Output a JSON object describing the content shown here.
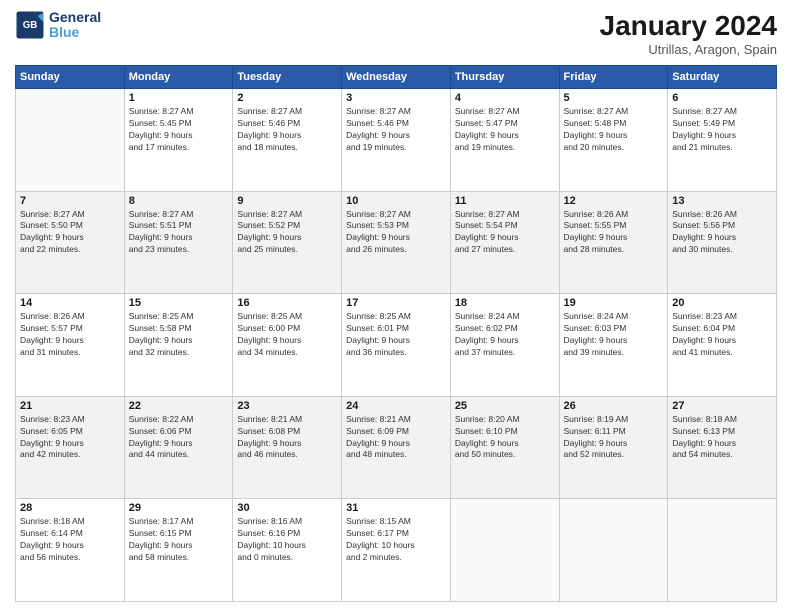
{
  "header": {
    "logo_line1": "General",
    "logo_line2": "Blue",
    "month": "January 2024",
    "location": "Utrillas, Aragon, Spain"
  },
  "weekdays": [
    "Sunday",
    "Monday",
    "Tuesday",
    "Wednesday",
    "Thursday",
    "Friday",
    "Saturday"
  ],
  "weeks": [
    [
      {
        "day": "",
        "info": ""
      },
      {
        "day": "1",
        "info": "Sunrise: 8:27 AM\nSunset: 5:45 PM\nDaylight: 9 hours\nand 17 minutes."
      },
      {
        "day": "2",
        "info": "Sunrise: 8:27 AM\nSunset: 5:46 PM\nDaylight: 9 hours\nand 18 minutes."
      },
      {
        "day": "3",
        "info": "Sunrise: 8:27 AM\nSunset: 5:46 PM\nDaylight: 9 hours\nand 19 minutes."
      },
      {
        "day": "4",
        "info": "Sunrise: 8:27 AM\nSunset: 5:47 PM\nDaylight: 9 hours\nand 19 minutes."
      },
      {
        "day": "5",
        "info": "Sunrise: 8:27 AM\nSunset: 5:48 PM\nDaylight: 9 hours\nand 20 minutes."
      },
      {
        "day": "6",
        "info": "Sunrise: 8:27 AM\nSunset: 5:49 PM\nDaylight: 9 hours\nand 21 minutes."
      }
    ],
    [
      {
        "day": "7",
        "info": "Sunrise: 8:27 AM\nSunset: 5:50 PM\nDaylight: 9 hours\nand 22 minutes."
      },
      {
        "day": "8",
        "info": "Sunrise: 8:27 AM\nSunset: 5:51 PM\nDaylight: 9 hours\nand 23 minutes."
      },
      {
        "day": "9",
        "info": "Sunrise: 8:27 AM\nSunset: 5:52 PM\nDaylight: 9 hours\nand 25 minutes."
      },
      {
        "day": "10",
        "info": "Sunrise: 8:27 AM\nSunset: 5:53 PM\nDaylight: 9 hours\nand 26 minutes."
      },
      {
        "day": "11",
        "info": "Sunrise: 8:27 AM\nSunset: 5:54 PM\nDaylight: 9 hours\nand 27 minutes."
      },
      {
        "day": "12",
        "info": "Sunrise: 8:26 AM\nSunset: 5:55 PM\nDaylight: 9 hours\nand 28 minutes."
      },
      {
        "day": "13",
        "info": "Sunrise: 8:26 AM\nSunset: 5:56 PM\nDaylight: 9 hours\nand 30 minutes."
      }
    ],
    [
      {
        "day": "14",
        "info": "Sunrise: 8:26 AM\nSunset: 5:57 PM\nDaylight: 9 hours\nand 31 minutes."
      },
      {
        "day": "15",
        "info": "Sunrise: 8:25 AM\nSunset: 5:58 PM\nDaylight: 9 hours\nand 32 minutes."
      },
      {
        "day": "16",
        "info": "Sunrise: 8:25 AM\nSunset: 6:00 PM\nDaylight: 9 hours\nand 34 minutes."
      },
      {
        "day": "17",
        "info": "Sunrise: 8:25 AM\nSunset: 6:01 PM\nDaylight: 9 hours\nand 36 minutes."
      },
      {
        "day": "18",
        "info": "Sunrise: 8:24 AM\nSunset: 6:02 PM\nDaylight: 9 hours\nand 37 minutes."
      },
      {
        "day": "19",
        "info": "Sunrise: 8:24 AM\nSunset: 6:03 PM\nDaylight: 9 hours\nand 39 minutes."
      },
      {
        "day": "20",
        "info": "Sunrise: 8:23 AM\nSunset: 6:04 PM\nDaylight: 9 hours\nand 41 minutes."
      }
    ],
    [
      {
        "day": "21",
        "info": "Sunrise: 8:23 AM\nSunset: 6:05 PM\nDaylight: 9 hours\nand 42 minutes."
      },
      {
        "day": "22",
        "info": "Sunrise: 8:22 AM\nSunset: 6:06 PM\nDaylight: 9 hours\nand 44 minutes."
      },
      {
        "day": "23",
        "info": "Sunrise: 8:21 AM\nSunset: 6:08 PM\nDaylight: 9 hours\nand 46 minutes."
      },
      {
        "day": "24",
        "info": "Sunrise: 8:21 AM\nSunset: 6:09 PM\nDaylight: 9 hours\nand 48 minutes."
      },
      {
        "day": "25",
        "info": "Sunrise: 8:20 AM\nSunset: 6:10 PM\nDaylight: 9 hours\nand 50 minutes."
      },
      {
        "day": "26",
        "info": "Sunrise: 8:19 AM\nSunset: 6:11 PM\nDaylight: 9 hours\nand 52 minutes."
      },
      {
        "day": "27",
        "info": "Sunrise: 8:18 AM\nSunset: 6:13 PM\nDaylight: 9 hours\nand 54 minutes."
      }
    ],
    [
      {
        "day": "28",
        "info": "Sunrise: 8:18 AM\nSunset: 6:14 PM\nDaylight: 9 hours\nand 56 minutes."
      },
      {
        "day": "29",
        "info": "Sunrise: 8:17 AM\nSunset: 6:15 PM\nDaylight: 9 hours\nand 58 minutes."
      },
      {
        "day": "30",
        "info": "Sunrise: 8:16 AM\nSunset: 6:16 PM\nDaylight: 10 hours\nand 0 minutes."
      },
      {
        "day": "31",
        "info": "Sunrise: 8:15 AM\nSunset: 6:17 PM\nDaylight: 10 hours\nand 2 minutes."
      },
      {
        "day": "",
        "info": ""
      },
      {
        "day": "",
        "info": ""
      },
      {
        "day": "",
        "info": ""
      }
    ]
  ]
}
